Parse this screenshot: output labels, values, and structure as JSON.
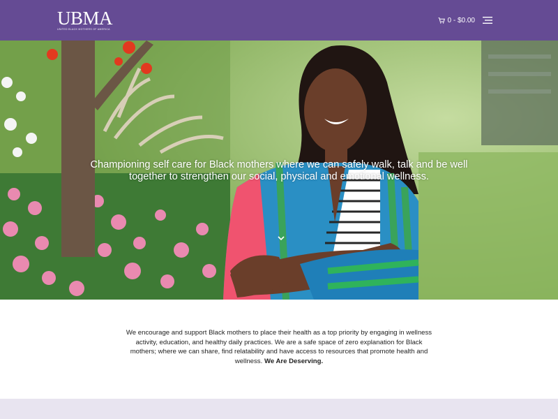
{
  "header": {
    "logo": "UBMA",
    "logo_subtitle": "United Black Mothers of America",
    "cart_text": "0 - $0.00",
    "icons": {
      "cart": "cart-icon",
      "menu": "hamburger-menu-icon"
    },
    "colors": {
      "bar": "#654b94"
    }
  },
  "hero": {
    "headline_line1": "Championing self care for Black mothers where we can safely walk, talk and be well",
    "headline_line2": "together to strengthen our social, physical and emotional wellness.",
    "scroll_icon": "chevron-down-icon"
  },
  "intro": {
    "text": "We encourage and support Black mothers to place their health as a top priority by engaging in wellness activity, education, and healthy daily practices. We are a safe space of zero explanation for Black mothers; where we can share, find relatability and have access to resources that promote health and wellness.",
    "emphasis": "We Are Deserving."
  },
  "colors": {
    "footer_band": "#e8e4f0"
  }
}
